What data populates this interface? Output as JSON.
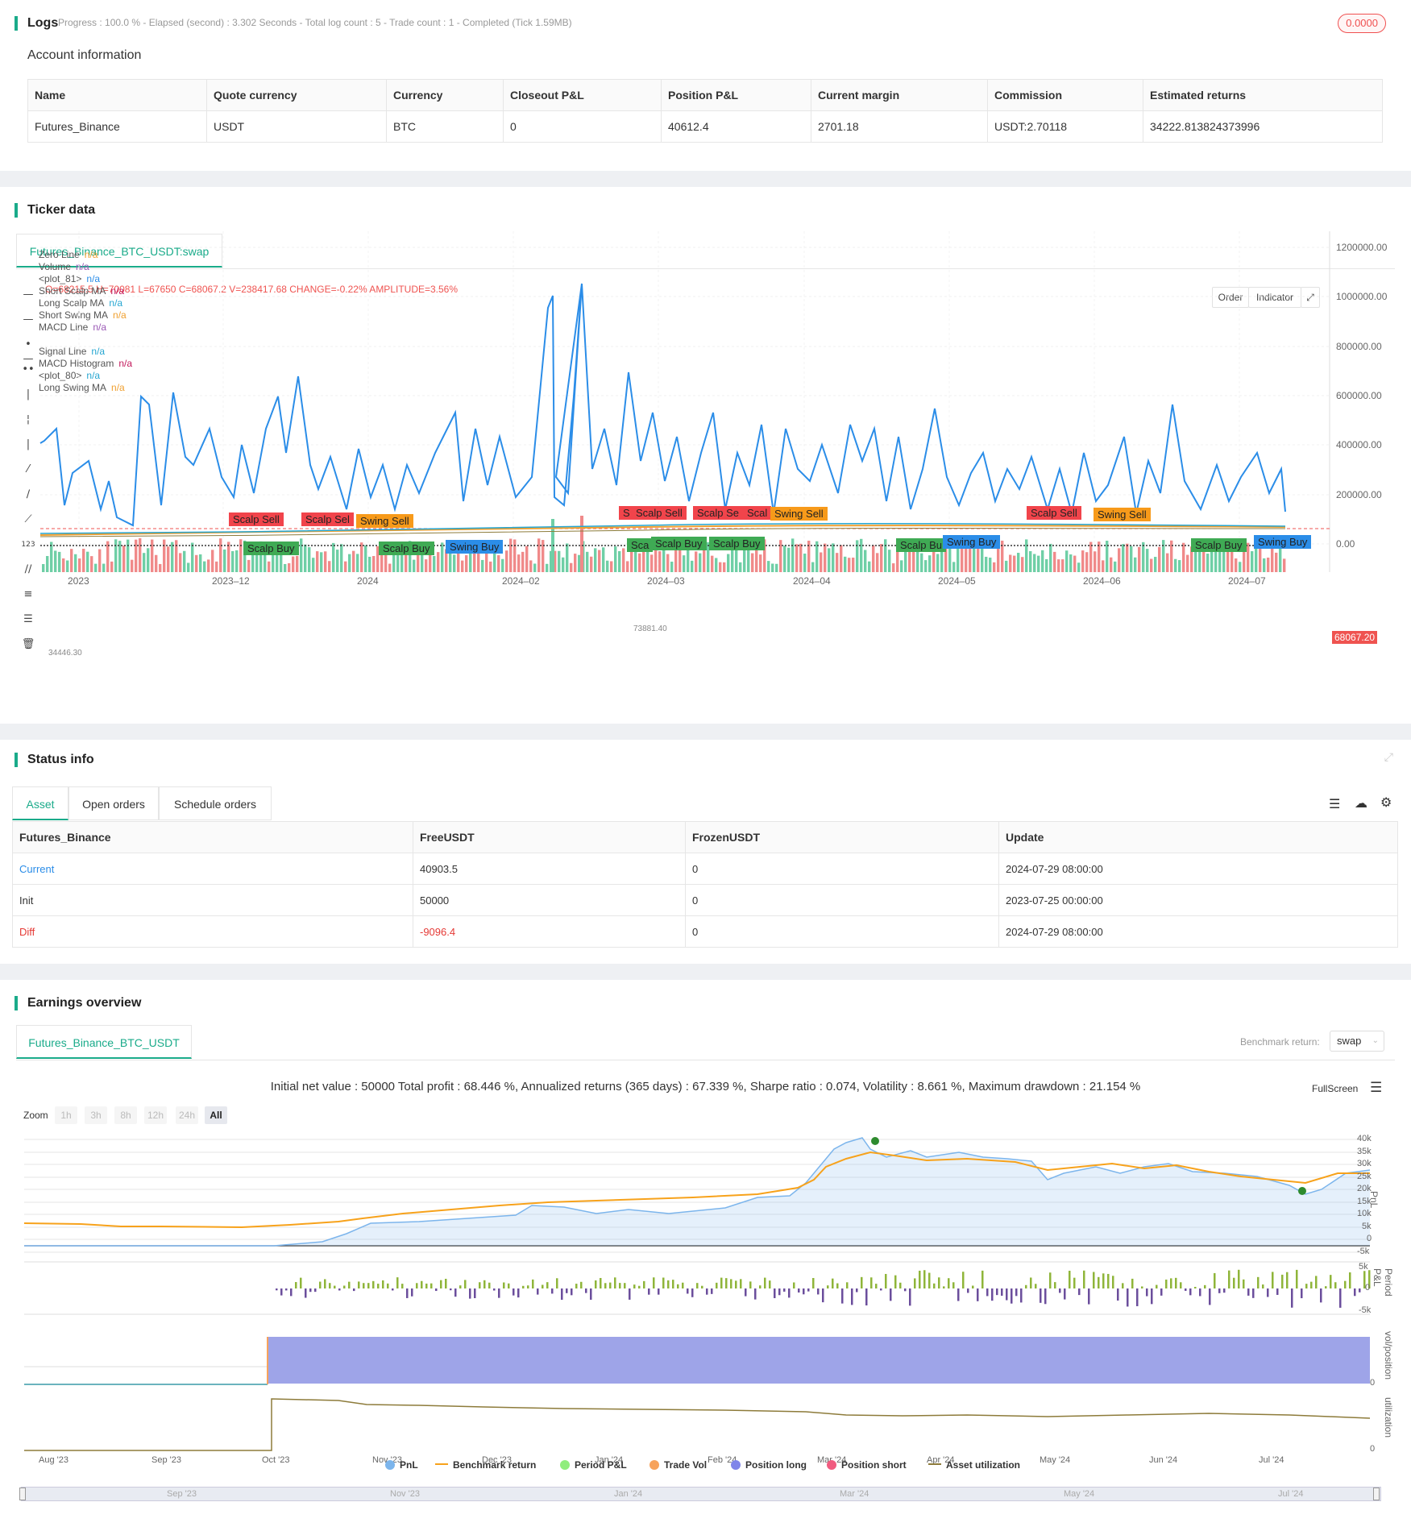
{
  "logs": {
    "title": "Logs",
    "status": "Progress : 100.0 % - Elapsed (second) : 3.302  Seconds - Total log count : 5 - Trade count : 1 - Completed (Tick 1.59MB)",
    "badge": "0.0000"
  },
  "account": {
    "title": "Account information",
    "headers": [
      "Name",
      "Quote currency",
      "Currency",
      "Closeout P&L",
      "Position P&L",
      "Current margin",
      "Commission",
      "Estimated returns"
    ],
    "row": [
      "Futures_Binance",
      "USDT",
      "BTC",
      "0",
      "40612.4",
      "2701.18",
      "USDT:2.70118",
      "34222.813824373996"
    ]
  },
  "ticker": {
    "title": "Ticker data",
    "tab": "Futures_Binance_BTC_USDT:swap",
    "ohlc": "O=68215.5 H=70081 L=67650 C=68067.2 V=238417.68 CHANGE=-0.22% AMPLITUDE=3.56%",
    "buttons": [
      "Order",
      "Indicator"
    ],
    "legend": [
      {
        "name": "Zero Line",
        "val": "n/a",
        "color": "#f0a030"
      },
      {
        "name": "Volume",
        "val": "n/a",
        "color": "#9b59b6"
      },
      {
        "name": "<plot_81>",
        "val": "n/a",
        "color": "#2b8de8"
      },
      {
        "name": "Short Scalp MA",
        "val": "n/a",
        "color": "#c2185b"
      },
      {
        "name": "Long Scalp MA",
        "val": "n/a",
        "color": "#26a6d1"
      },
      {
        "name": "Short Swing MA",
        "val": "n/a",
        "color": "#f0a030"
      },
      {
        "name": "MACD Line",
        "val": "n/a",
        "color": "#9b59b6"
      },
      {
        "name": "Signal Line",
        "val": "n/a",
        "color": "#26a6d1"
      },
      {
        "name": "MACD Histogram",
        "val": "n/a",
        "color": "#c2185b"
      },
      {
        "name": "<plot_80>",
        "val": "n/a",
        "color": "#26a6d1"
      },
      {
        "name": "Long Swing MA",
        "val": "n/a",
        "color": "#f0a030"
      }
    ],
    "y_labels": [
      "1200000.00",
      "1000000.00",
      "800000.00",
      "600000.00",
      "400000.00",
      "200000.00",
      "0.00"
    ],
    "price_tag": "68067.20",
    "x_labels": [
      "2023",
      "2023–12",
      "2024",
      "2024–02",
      "2024–03",
      "2024–04",
      "2024–05",
      "2024–06",
      "2024–07"
    ],
    "low_marker": "34446.30",
    "high_marker": "73881.40",
    "signals": [
      {
        "label": "Scalp Sell",
        "kind": "sell"
      },
      {
        "label": "Scalp Sel",
        "kind": "sell"
      },
      {
        "label": "Swing Sell",
        "kind": "swsell"
      },
      {
        "label": "S",
        "kind": "sell"
      },
      {
        "label": "Scalp Sell",
        "kind": "sell"
      },
      {
        "label": "Scalp Se",
        "kind": "sell"
      },
      {
        "label": "Scal",
        "kind": "sell"
      },
      {
        "label": "Swing Sell",
        "kind": "swsell"
      },
      {
        "label": "Scalp Sell",
        "kind": "sell"
      },
      {
        "label": "Swing Sell",
        "kind": "swsell"
      },
      {
        "label": "Scalp Buy",
        "kind": "buy"
      },
      {
        "label": "Scalp Buy",
        "kind": "buy"
      },
      {
        "label": "Swing Buy",
        "kind": "swbuy"
      },
      {
        "label": "Sca",
        "kind": "buy"
      },
      {
        "label": "Scalp Buy",
        "kind": "buy"
      },
      {
        "label": "Scalp Buy",
        "kind": "buy"
      },
      {
        "label": "Scalp Bu",
        "kind": "buy"
      },
      {
        "label": "Swing Buy",
        "kind": "swbuy"
      },
      {
        "label": "Scalp Buy",
        "kind": "buy"
      },
      {
        "label": "Swing Buy",
        "kind": "swbuy"
      }
    ]
  },
  "status": {
    "title": "Status info",
    "tabs": [
      "Asset",
      "Open orders",
      "Schedule orders"
    ],
    "headers": [
      "Futures_Binance",
      "FreeUSDT",
      "FrozenUSDT",
      "Update"
    ],
    "rows": [
      {
        "label": "Current",
        "free": "40903.5",
        "frozen": "0",
        "update": "2024-07-29 08:00:00"
      },
      {
        "label": "Init",
        "free": "50000",
        "frozen": "0",
        "update": "2023-07-25 00:00:00"
      },
      {
        "label": "Diff",
        "free": "-9096.4",
        "frozen": "0",
        "update": "2024-07-29 08:00:00"
      }
    ]
  },
  "earnings": {
    "title": "Earnings overview",
    "tab": "Futures_Binance_BTC_USDT",
    "benchmark_label": "Benchmark return:",
    "benchmark_value": "swap",
    "summary": "Initial net value : 50000 Total profit : 68.446 %, Annualized returns (365 days) : 67.339 %, Sharpe ratio : 0.074, Volatility : 8.661 %, Maximum drawdown : 21.154 %",
    "fullscreen": "FullScreen",
    "zoom_label": "Zoom",
    "zoom_buttons": [
      "1h",
      "3h",
      "8h",
      "12h",
      "24h",
      "All"
    ],
    "pnl_axis": [
      "40k",
      "35k",
      "30k",
      "25k",
      "20k",
      "15k",
      "10k",
      "5k",
      "0",
      "-5k"
    ],
    "pnl_title": "PnL",
    "period_axis": [
      "5k",
      "0",
      "-5k"
    ],
    "period_title": "Period P&L",
    "vol_axis": [
      "0"
    ],
    "vol_title": "vol/position",
    "util_axis": [
      "0"
    ],
    "util_title": "utilization",
    "x_labels": [
      "Aug '23",
      "Sep '23",
      "Oct '23",
      "Nov '23",
      "Dec '23",
      "Jan '24",
      "Feb '24",
      "Mar '24",
      "Apr '24",
      "May '24",
      "Jun '24",
      "Jul '24"
    ],
    "nav_labels": [
      "Sep '23",
      "Nov '23",
      "Jan '24",
      "Mar '24",
      "May '24",
      "Jul '24"
    ],
    "legend": [
      {
        "name": "PnL",
        "color": "#7cb5ec",
        "shape": "dot"
      },
      {
        "name": "Benchmark return",
        "color": "#f7a21b",
        "shape": "line"
      },
      {
        "name": "Period P&L",
        "color": "#90ed7d",
        "shape": "dot"
      },
      {
        "name": "Trade Vol",
        "color": "#f7a35c",
        "shape": "dot"
      },
      {
        "name": "Position long",
        "color": "#8085e9",
        "shape": "dot"
      },
      {
        "name": "Position short",
        "color": "#f15c80",
        "shape": "dot"
      },
      {
        "name": "Asset utilization",
        "color": "#8d7b3a",
        "shape": "line"
      }
    ]
  }
}
